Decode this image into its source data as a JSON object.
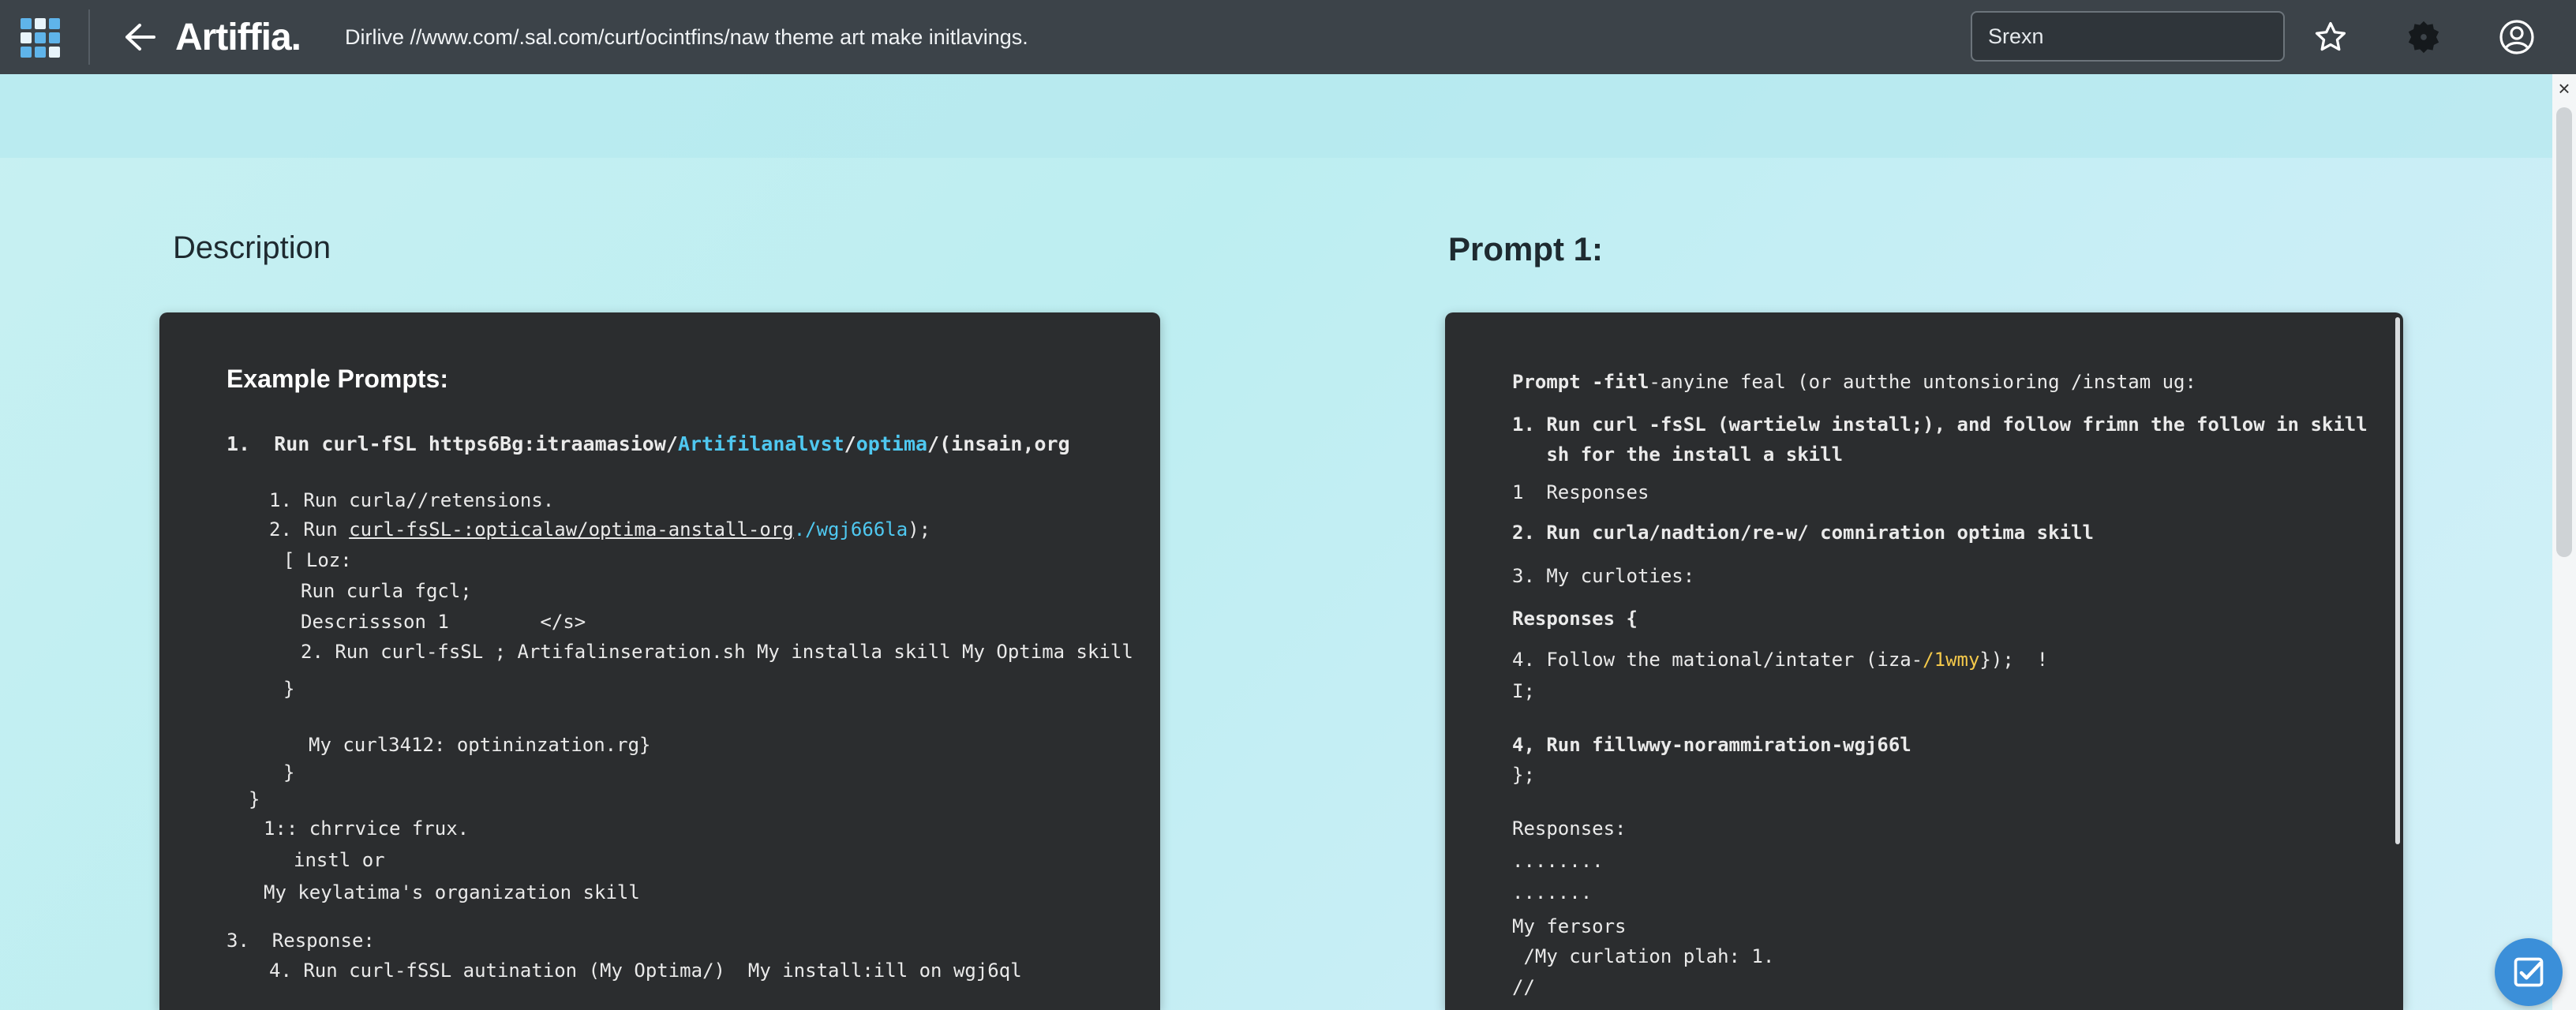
{
  "header": {
    "brand": "Artiffia.",
    "url": "Dirlive //www.com/.sal.com/curt/ocintfins/naw theme art make initlavings.",
    "search_value": "Srexn",
    "icons": [
      "apps-grid-icon",
      "back-arrow-icon",
      "star-icon",
      "puzzle-extension-icon",
      "account-icon"
    ]
  },
  "left": {
    "title": "Description",
    "heading": "Example Prompts:",
    "lines": {
      "l1_pre": "1.  Run curl-fSL https6Bg:itraamasiow/",
      "l1_link1": "Artifilanalvst",
      "l1_sep": "/",
      "l1_link2": "optima",
      "l1_post": "/(insain,org",
      "l2": "1. Run curla//retensions.",
      "l3_pre": "2. Run ",
      "l3_ul": "curl-fsSL-:opticalaw/optima-anstall-org",
      "l3_link": "./wgj666la",
      "l3_post": ");",
      "l4": "[ Loz:",
      "l5": "Run curla fgcl;",
      "l6": "Descrissson 1        </s>",
      "l7": "2. Run curl-fsSL ; Artifalinseration.sh My installa skill My Optima skill",
      "l8": "}",
      "l9": "My curl3412: optininzation.rg}",
      "l10": "}",
      "l11": "}",
      "l12": "1:: chrrvice frux.",
      "l13": "instl or",
      "l14": "My keylatima's organization skill",
      "l15": "3.  Response:",
      "l16": "4. Run curl-fSSL autination (My Optima/)  My install:ill on wgj6ql"
    }
  },
  "right": {
    "title": "Prompt 1:",
    "lines": {
      "r1_bold": "Prompt -fitl",
      "r1_rest": "-anyine feal (or autthe untonsioring /instam ug:",
      "r2": "1. Run curl -fsSL (wartielw install;), and follow frimn the follow in skill",
      "r3": "   sh for the install a skill",
      "r4": "1  Responses",
      "r5": "2. Run curla/nadtion/re-w/ comniration optima skill",
      "r6": "3. My curloties:",
      "r7": "Responses {",
      "r8_pre": "4. Follow the mational/intater (iza-",
      "r8_yel": "/1wmy",
      "r8_post": "});  !",
      "r9": "I;",
      "r10": "4, Run fillwwy-norammiration-wgj66l",
      "r11": "};",
      "r12": "Responses:",
      "r13": "........",
      "r14": ".......",
      "r15": "My fersors",
      "r16": " /My curlation plah: 1.",
      "r17": "//"
    }
  },
  "colors": {
    "topbar": "#3c4349",
    "panel": "#2b2d2f",
    "link": "#4fc8f0",
    "highlight": "#f3c84a",
    "fab": "#3b8fd9"
  }
}
